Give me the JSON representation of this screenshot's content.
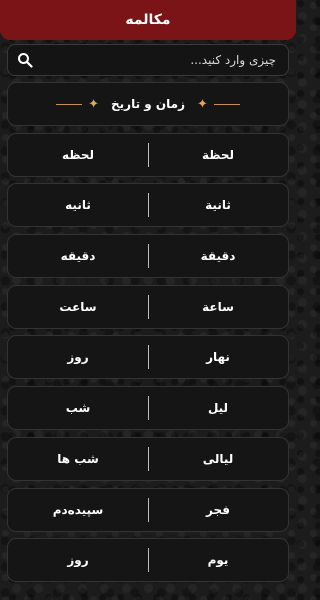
{
  "header": {
    "title": "مکالمه"
  },
  "search": {
    "placeholder": "چیزی وارد کنید..."
  },
  "section": {
    "title": "زمان و تاریخ"
  },
  "entries": [
    {
      "arabic": "لحظة",
      "persian": "لحظه"
    },
    {
      "arabic": "ثانية",
      "persian": "ثانیه"
    },
    {
      "arabic": "دقيقة",
      "persian": "دقیقه"
    },
    {
      "arabic": "ساعة",
      "persian": "ساعت"
    },
    {
      "arabic": "نهار",
      "persian": "روز"
    },
    {
      "arabic": "ليل",
      "persian": "شب"
    },
    {
      "arabic": "ليالى",
      "persian": "شب ها"
    },
    {
      "arabic": "فجر",
      "persian": "سپیده‌دم"
    },
    {
      "arabic": "يوم",
      "persian": "روز"
    }
  ],
  "colors": {
    "header_bg": "#7a1416",
    "ornament": "#e0a85c"
  },
  "icons": {
    "search": "search-icon",
    "ornament": "diamond-star-icon"
  }
}
